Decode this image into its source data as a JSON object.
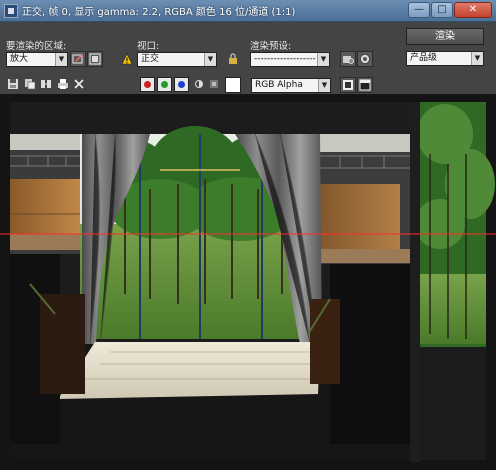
{
  "window": {
    "title": "正交, 帧 0, 显示 gamma: 2.2, RGBA 颜色 16 位/通道 (1:1)",
    "minimize_label": "—",
    "maximize_label": "□",
    "close_label": "✕"
  },
  "toolbar": {
    "area_label": "要渲染的区域:",
    "area_value": "放大",
    "viewport_label": "视口:",
    "viewport_value": "正交",
    "preset_label": "渲染预设:",
    "preset_value": "-------------------",
    "render_button": "渲染",
    "quality_value": "产品级",
    "channel_value": "RGB Alpha"
  },
  "colors": {
    "red_channel": "#d11c1c",
    "green_channel": "#1f9b2a",
    "blue_channel": "#1c3fd1",
    "crosshair": "#ff2a2a"
  },
  "icons": [
    "area-edit-icon",
    "area-auto-icon",
    "warning-icon",
    "lock-icon",
    "render-setup-icon",
    "environment-icon",
    "save-icon",
    "copy-icon",
    "clone-icon",
    "print-icon",
    "clear-icon",
    "alpha-toggle-icon",
    "mono-icon",
    "display-icon"
  ]
}
